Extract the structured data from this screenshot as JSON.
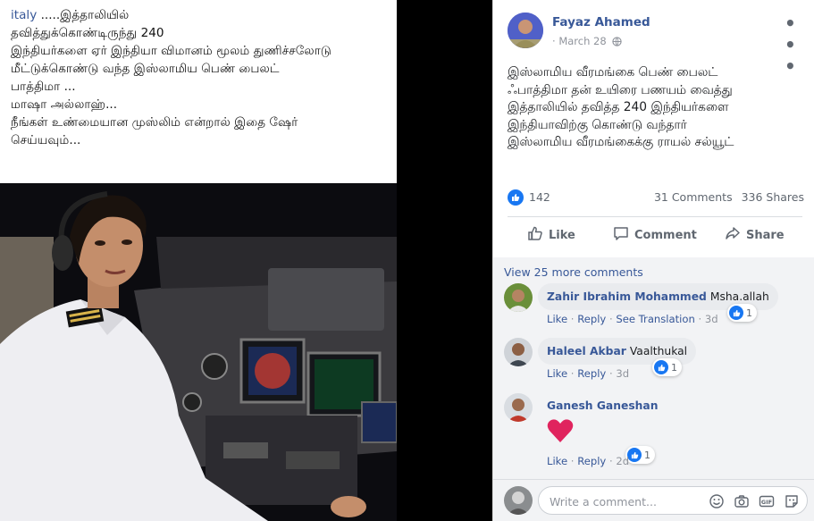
{
  "caption": {
    "link": "italy",
    "line1_rest": " .....இத்தாலியில்",
    "lines": [
      "தவித்துக்கொண்டிருந்து 240",
      "இந்தியர்களை ஏர் இந்தியா விமானம் மூலம் துணிச்சலோடு",
      "மீட்டுக்கொண்டு வந்த இஸ்லாமிய பெண் பைலட்",
      "பாத்திமா ...",
      "மாஷா அல்லாஹ்...",
      "",
      "நீங்கள் உண்மையான முஸ்லிம் என்றால் இதை ஷேர்",
      "செய்யவும்..."
    ]
  },
  "post": {
    "author": "Fayaz Ahamed",
    "date": "March 28",
    "text_lines": [
      "இஸ்லாமிய வீரமங்கை பெண் பைலட்",
      "ஃபாத்திமா தன் உயிரை பணயம் வைத்து",
      "இத்தாலியில் தவித்த 240 இந்தியர்களை",
      "இந்தியாவிற்கு கொண்டு வந்தார்",
      "இஸ்லாமிய வீரமங்கைக்கு ராயல் சல்யூட்"
    ],
    "reactions_count": "142",
    "comments_count": "31 Comments",
    "shares_count": "336 Shares"
  },
  "actions": {
    "like": "Like",
    "comment": "Comment",
    "share": "Share"
  },
  "comments": {
    "view_more": "View 25 more comments",
    "items": [
      {
        "author": "Zahir Ibrahim Mohammed",
        "text": "Msha.allah",
        "like": "Like",
        "reply": "Reply",
        "translate": "See Translation",
        "time": "3d",
        "reactions": "1"
      },
      {
        "author": "Haleel Akbar",
        "text": "Vaalthukal",
        "like": "Like",
        "reply": "Reply",
        "time": "3d",
        "reactions": "1"
      },
      {
        "author": "Ganesh Ganeshan",
        "text": "",
        "like": "Like",
        "reply": "Reply",
        "time": "2d",
        "reactions": "1"
      }
    ]
  },
  "composer": {
    "placeholder": "Write a comment..."
  },
  "colors": {
    "link": "#385898",
    "like_blue": "#1877f2",
    "heart": "#e0245e"
  }
}
